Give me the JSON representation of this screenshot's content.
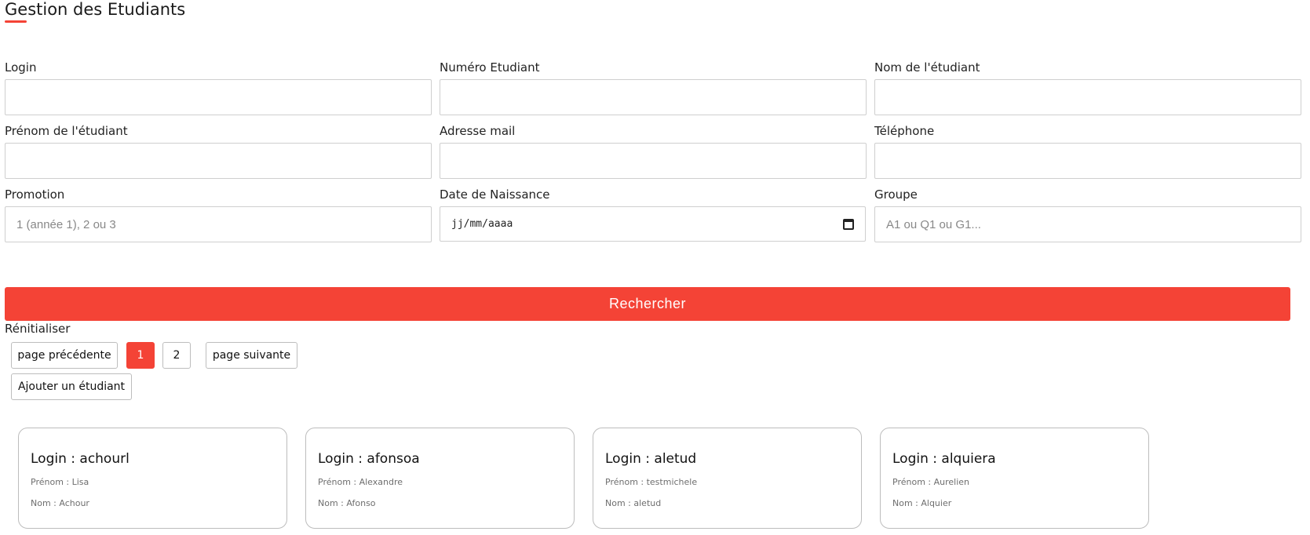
{
  "page": {
    "title": "Gestion des Etudiants"
  },
  "form": {
    "login": {
      "label": "Login",
      "value": "",
      "placeholder": ""
    },
    "numero": {
      "label": "Numéro Etudiant",
      "value": "",
      "placeholder": ""
    },
    "nom": {
      "label": "Nom de l'étudiant",
      "value": "",
      "placeholder": ""
    },
    "prenom": {
      "label": "Prénom de l'étudiant",
      "value": "",
      "placeholder": ""
    },
    "email": {
      "label": "Adresse mail",
      "value": "",
      "placeholder": ""
    },
    "telephone": {
      "label": "Téléphone",
      "value": "",
      "placeholder": ""
    },
    "promotion": {
      "label": "Promotion",
      "value": "",
      "placeholder": "1 (année 1), 2 ou 3"
    },
    "date_naissance": {
      "label": "Date de Naissance",
      "value": "jj/mm/aaaa"
    },
    "groupe": {
      "label": "Groupe",
      "value": "",
      "placeholder": "A1 ou Q1 ou G1..."
    }
  },
  "actions": {
    "search_label": "Rechercher",
    "reset_label": "Rénitialiser",
    "add_label": "Ajouter un étudiant"
  },
  "pagination": {
    "prev_label": "page précédente",
    "next_label": "page suivante",
    "pages": [
      "1",
      "2"
    ],
    "current_page": "1"
  },
  "students": [
    {
      "login": "Login : achourl",
      "prenom": "Prénom : Lisa",
      "nom": "Nom : Achour"
    },
    {
      "login": "Login : afonsoa",
      "prenom": "Prénom : Alexandre",
      "nom": "Nom : Afonso"
    },
    {
      "login": "Login : aletud",
      "prenom": "Prénom : testmichele",
      "nom": "Nom : aletud"
    },
    {
      "login": "Login : alquiera",
      "prenom": "Prénom : Aurelien",
      "nom": "Nom : Alquier"
    }
  ],
  "colors": {
    "accent": "#f44336",
    "border": "#cfcfcf"
  },
  "icons": {
    "date_picker": "calendar-icon"
  }
}
